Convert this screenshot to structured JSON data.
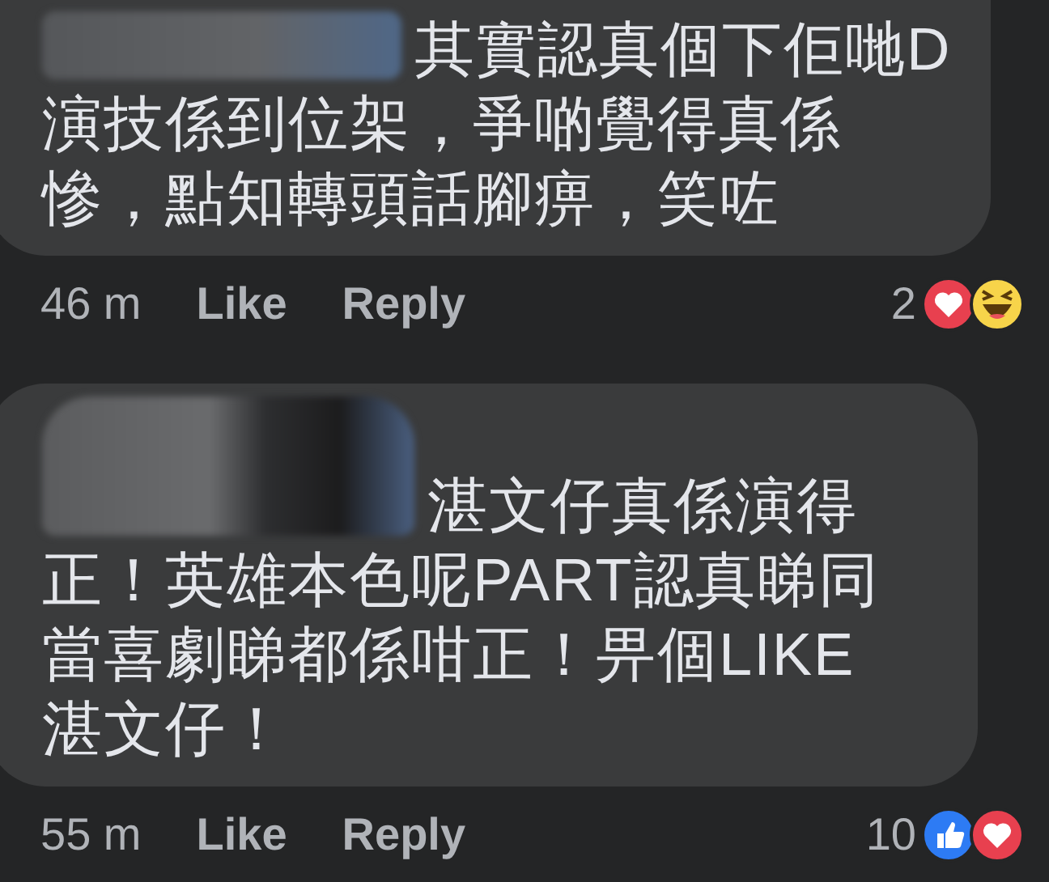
{
  "comments": [
    {
      "name_redacted": true,
      "text": "其實認真個下佢哋D演技係到位架，爭啲覺得真係慘，點知轉頭話腳痹，笑咗",
      "time": "46 m",
      "actions": [
        "Like",
        "Reply"
      ],
      "reaction_count": "2",
      "reactions": [
        {
          "kind": "love"
        },
        {
          "kind": "haha"
        }
      ]
    },
    {
      "name_redacted": true,
      "text": "湛文仔真係演得正！英雄本色呢PART認真睇同當喜劇睇都係咁正！畀個LIKE湛文仔！",
      "time": "55 m",
      "actions": [
        "Like",
        "Reply"
      ],
      "reaction_count": "10",
      "reactions": [
        {
          "kind": "like"
        },
        {
          "kind": "love"
        }
      ]
    }
  ]
}
